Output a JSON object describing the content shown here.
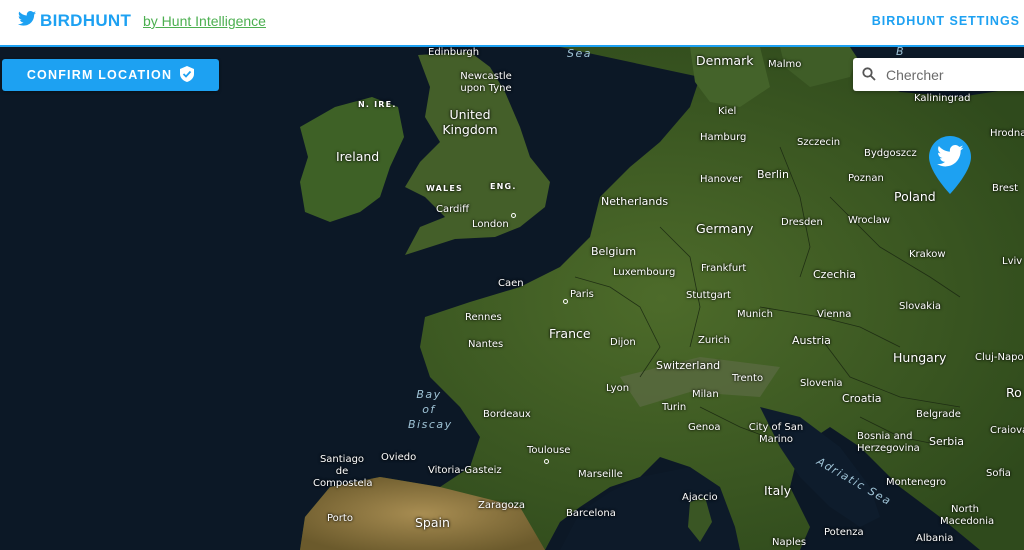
{
  "header": {
    "brand": "BIRDHUNT",
    "byline": "by Hunt Intelligence",
    "settings": "BIRDHUNT SETTINGS",
    "brand_color": "#1da1f2",
    "byline_color": "#4caf50"
  },
  "map": {
    "confirm_label": "CONFIRM LOCATION",
    "search_placeholder": "Chercher",
    "marker_icon": "twitter-bird-icon",
    "countries": {
      "ireland": "Ireland",
      "united_kingdom": "United Kingdom",
      "netherlands": "Netherlands",
      "belgium": "Belgium",
      "luxembourg": "Luxembourg",
      "france": "France",
      "germany": "Germany",
      "denmark": "Denmark",
      "poland": "Poland",
      "czechia": "Czechia",
      "slovakia": "Slovakia",
      "austria": "Austria",
      "hungary": "Hungary",
      "switzerland": "Switzerland",
      "slovenia": "Slovenia",
      "croatia": "Croatia",
      "bosnia_and_herzegovina": "Bosnia and Herzegovina",
      "serbia": "Serbia",
      "montenegro": "Montenegro",
      "north_macedonia": "North Macedonia",
      "italy": "Italy",
      "spain": "Spain",
      "portugal": "Porto",
      "san_marino": "City of San Marino"
    },
    "regions": {
      "n_ire": "N. IRE.",
      "wales": "WALES",
      "eng": "ENG."
    },
    "seas": {
      "north_sea": "Sea",
      "bay_of_biscay": "Bay of Biscay",
      "adriatic": "Adriatic Sea",
      "baltic": "B"
    },
    "cities": {
      "edinburgh": "Edinburgh",
      "newcastle": "Newcastle upon Tyne",
      "cardiff": "Cardiff",
      "london": "London",
      "caen": "Caen",
      "paris": "Paris",
      "rennes": "Rennes",
      "nantes": "Nantes",
      "bordeaux": "Bordeaux",
      "toulouse": "Toulouse",
      "marseille": "Marseille",
      "lyon": "Lyon",
      "dijon": "Dijon",
      "zurich": "Zurich",
      "milan": "Milan",
      "turin": "Turin",
      "genoa": "Genoa",
      "trento": "Trento",
      "ajaccio": "Ajaccio",
      "barcelona": "Barcelona",
      "zaragoza": "Zaragoza",
      "vitoria": "Vitoria-Gasteiz",
      "oviedo": "Oviedo",
      "santiago": "Santiago de Compostela",
      "frankfurt": "Frankfurt",
      "stuttgart": "Stuttgart",
      "munich": "Munich",
      "vienna": "Vienna",
      "hanover": "Hanover",
      "hamburg": "Hamburg",
      "kiel": "Kiel",
      "berlin": "Berlin",
      "dresden": "Dresden",
      "szczecin": "Szczecin",
      "bydgoszcz": "Bydgoszcz",
      "poznan": "Poznan",
      "wroclaw": "Wroclaw",
      "krakow": "Krakow",
      "kaliningrad": "Kaliningrad",
      "hrodna": "Hrodna",
      "brest": "Brest",
      "lviv": "Lviv",
      "malmo": "Malmo",
      "belgrade": "Belgrade",
      "cluj": "Cluj-Napoc",
      "craiova": "Craiova",
      "sofia": "Sofia",
      "naples": "Naples",
      "potenza": "Potenza",
      "albania": "Albania",
      "skopje_country": "Macedonia",
      "bucharest": "Ro"
    }
  }
}
